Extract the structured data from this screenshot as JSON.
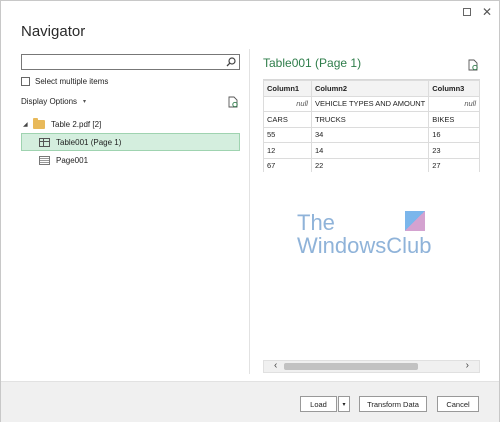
{
  "window": {
    "title": "Navigator",
    "maximize_glyph": "☐",
    "close_glyph": "✕"
  },
  "search": {
    "value": "",
    "placeholder": ""
  },
  "options": {
    "select_multiple": "Select multiple items",
    "display_options": "Display Options",
    "chevron": "▾"
  },
  "tree": {
    "root": {
      "caret": "◢",
      "label": "Table 2.pdf [2]"
    },
    "items": [
      {
        "label": "Table001 (Page 1)",
        "selected": true,
        "icon": "table-icon"
      },
      {
        "label": "Page001",
        "selected": false,
        "icon": "page-icon"
      }
    ]
  },
  "preview": {
    "title": "Table001 (Page 1)",
    "columns": [
      "Column1",
      "Column2",
      "Column3"
    ],
    "rows": [
      [
        "null",
        "VEHICLE TYPES AND AMOUNT",
        "null"
      ],
      [
        "CARS",
        "TRUCKS",
        "BIKES"
      ],
      [
        "55",
        "34",
        "16"
      ],
      [
        "12",
        "14",
        "23"
      ],
      [
        "67",
        "22",
        "27"
      ]
    ]
  },
  "watermark": {
    "line1": "The",
    "line2": "WindowsClub"
  },
  "scrollbar": {
    "left_arrow": "‹",
    "right_arrow": "›"
  },
  "footer": {
    "load": "Load",
    "load_dropdown": "▾",
    "transform": "Transform Data",
    "cancel": "Cancel"
  },
  "colors": {
    "accent": "#2e7d4a",
    "selected_bg": "#d4eede"
  }
}
